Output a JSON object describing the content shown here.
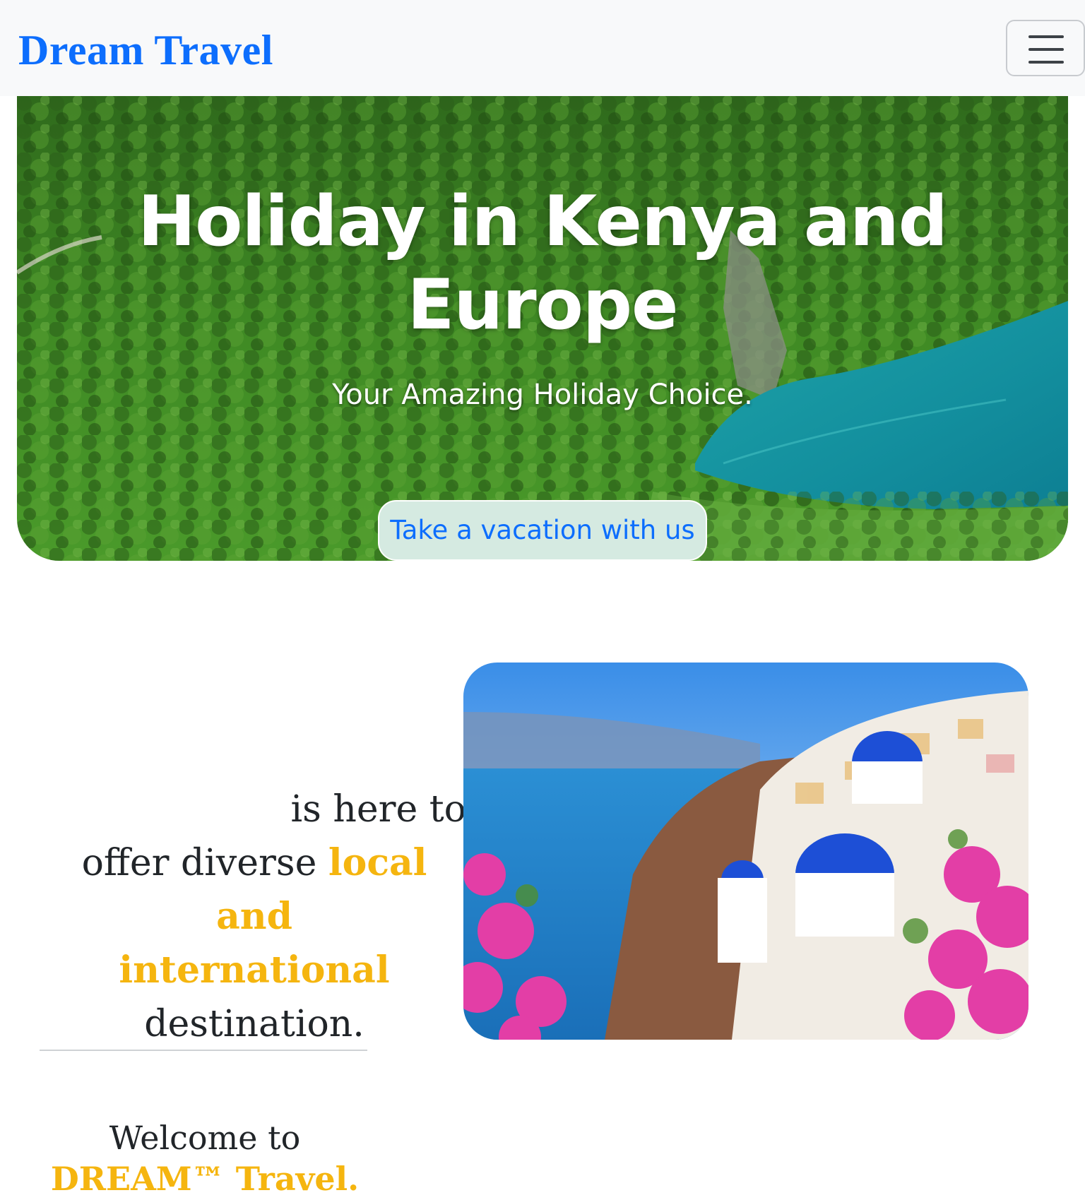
{
  "navbar": {
    "brand": "Dream Travel",
    "menu_icon": "hamburger-menu-icon"
  },
  "hero": {
    "title": "Holiday in Kenya and Europe",
    "subtitle": "Your Amazing Holiday Choice.",
    "cta_label": "Take a vacation with us"
  },
  "about": {
    "line1": "is here to",
    "line2_pre": "offer diverse ",
    "highlight1": "local and",
    "highlight2": "international",
    "line4": "destination."
  },
  "welcome": {
    "pre": "Welcome to ",
    "highlight": "DREAM™ Travel."
  },
  "colors": {
    "brand": "#0d6efd",
    "highlight": "#f5b50f",
    "navbar_bg": "#f8f9fa",
    "text": "#212529"
  }
}
